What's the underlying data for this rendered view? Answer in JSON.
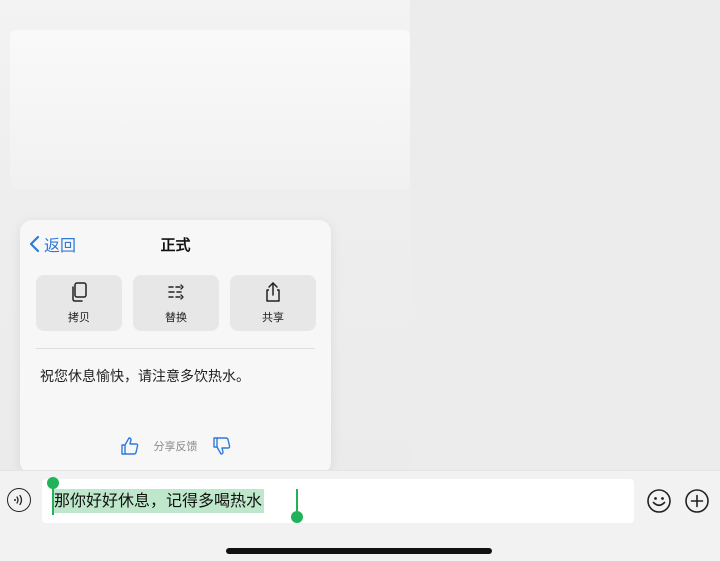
{
  "popup": {
    "back_label": "返回",
    "title": "正式",
    "actions": [
      {
        "label": "拷贝",
        "icon": "copy-icon"
      },
      {
        "label": "替换",
        "icon": "replace-icon"
      },
      {
        "label": "共享",
        "icon": "share-icon"
      }
    ],
    "result_text": "祝您休息愉快，请注意多饮热水。",
    "feedback_label": "分享反馈"
  },
  "input": {
    "text": "那你好好休息，记得多喝热水"
  },
  "colors": {
    "accent_blue": "#2f7ad8",
    "selection_green": "#22b35a",
    "selection_bg": "#bfe7cc"
  }
}
